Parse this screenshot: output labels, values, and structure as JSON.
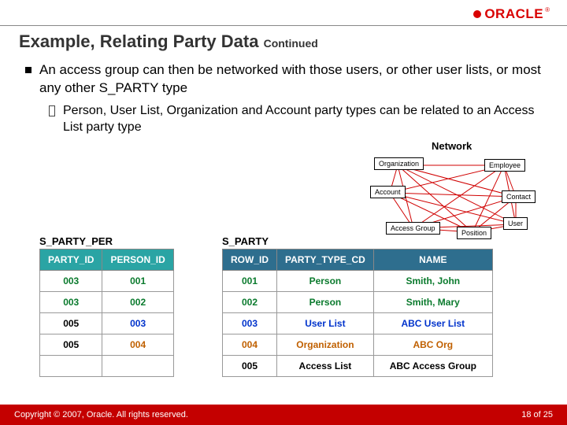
{
  "logo": {
    "text": "ORACLE",
    "reg": "®"
  },
  "title": {
    "main": "Example, Relating Party Data",
    "cont": "Continued"
  },
  "bullets": {
    "b1": "An access group can then be networked with those users, or other user lists, or most any other S_PARTY type",
    "b2": "Person, User List, Organization and Account party types can be related to an Access List party type"
  },
  "network": {
    "label": "Network",
    "nodes": [
      "Organization",
      "Employee",
      "Account",
      "Contact",
      "Access Group",
      "Position",
      "User"
    ]
  },
  "tables": {
    "per": {
      "caption": "S_PARTY_PER",
      "headers": [
        "PARTY_ID",
        "PERSON_ID"
      ],
      "rows": [
        [
          {
            "v": "003",
            "c": "c-green"
          },
          {
            "v": "001",
            "c": "c-green"
          }
        ],
        [
          {
            "v": "003",
            "c": "c-green"
          },
          {
            "v": "002",
            "c": "c-green"
          }
        ],
        [
          {
            "v": "005",
            "c": "c-black"
          },
          {
            "v": "003",
            "c": "c-blue"
          }
        ],
        [
          {
            "v": "005",
            "c": "c-black"
          },
          {
            "v": "004",
            "c": "c-orange"
          }
        ],
        [
          {
            "v": "",
            "c": ""
          },
          {
            "v": "",
            "c": ""
          }
        ]
      ]
    },
    "party": {
      "caption": "S_PARTY",
      "headers": [
        "ROW_ID",
        "PARTY_TYPE_CD",
        "NAME"
      ],
      "rows": [
        [
          {
            "v": "001",
            "c": "c-green"
          },
          {
            "v": "Person",
            "c": "c-green"
          },
          {
            "v": "Smith, John",
            "c": "c-green"
          }
        ],
        [
          {
            "v": "002",
            "c": "c-green"
          },
          {
            "v": "Person",
            "c": "c-green"
          },
          {
            "v": "Smith, Mary",
            "c": "c-green"
          }
        ],
        [
          {
            "v": "003",
            "c": "c-blue"
          },
          {
            "v": "User List",
            "c": "c-blue"
          },
          {
            "v": "ABC User List",
            "c": "c-blue"
          }
        ],
        [
          {
            "v": "004",
            "c": "c-orange"
          },
          {
            "v": "Organization",
            "c": "c-orange"
          },
          {
            "v": "ABC Org",
            "c": "c-orange"
          }
        ],
        [
          {
            "v": "005",
            "c": "c-black"
          },
          {
            "v": "Access List",
            "c": "c-black"
          },
          {
            "v": "ABC Access Group",
            "c": "c-black"
          }
        ]
      ]
    }
  },
  "footer": {
    "copyright": "Copyright © 2007, Oracle. All rights reserved.",
    "page_current": "18",
    "page_of": " of ",
    "page_total": "25"
  }
}
